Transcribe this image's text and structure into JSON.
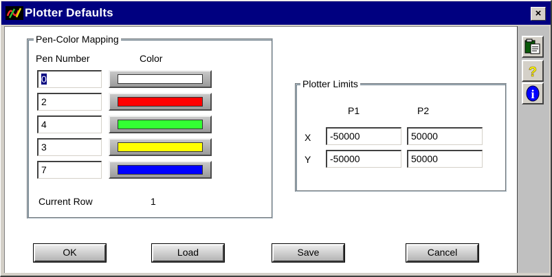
{
  "window": {
    "title": "Plotter Defaults",
    "close_label": "×"
  },
  "pen_mapping": {
    "caption": "Pen-Color Mapping",
    "pen_number_header": "Pen Number",
    "color_header": "Color",
    "rows": [
      {
        "pen": "0",
        "color": "#ffffff"
      },
      {
        "pen": "2",
        "color": "#ff0000"
      },
      {
        "pen": "4",
        "color": "#33ff33"
      },
      {
        "pen": "3",
        "color": "#ffff00"
      },
      {
        "pen": "7",
        "color": "#0000ff"
      }
    ],
    "current_row_label": "Current Row",
    "current_row_value": "1"
  },
  "plotter_limits": {
    "caption": "Plotter Limits",
    "p1_header": "P1",
    "p2_header": "P2",
    "x_label": "X",
    "y_label": "Y",
    "x_p1": "-50000",
    "x_p2": "50000",
    "y_p1": "-50000",
    "y_p2": "50000"
  },
  "buttons": {
    "ok": "OK",
    "load": "Load",
    "save": "Save",
    "cancel": "Cancel"
  },
  "toolbar": {
    "items": [
      "clipboard-icon",
      "help-question-icon",
      "info-icon"
    ],
    "help_glyph": "?",
    "info_glyph": "i"
  },
  "colors": {
    "titlebar": "#000080",
    "dialog_bg": "#ffffff",
    "toolstrip_bg": "#c0c0c0"
  }
}
